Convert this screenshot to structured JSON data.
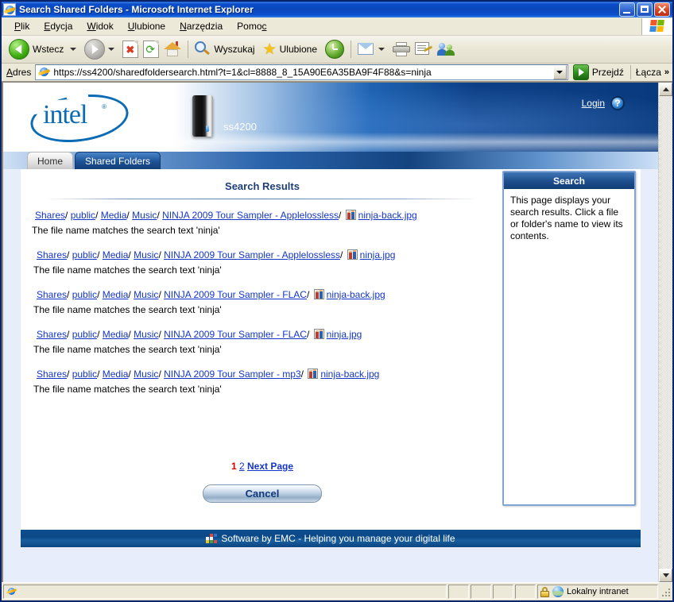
{
  "window": {
    "title": "Search Shared Folders - Microsoft Internet Explorer",
    "minimize_label": "Minimize",
    "maximize_label": "Maximize",
    "close_label": "Close"
  },
  "menu": {
    "items": [
      {
        "prefix": "",
        "accel": "P",
        "suffix": "lik"
      },
      {
        "prefix": "",
        "accel": "E",
        "suffix": "dycja"
      },
      {
        "prefix": "",
        "accel": "W",
        "suffix": "idok"
      },
      {
        "prefix": "",
        "accel": "U",
        "suffix": "lubione"
      },
      {
        "prefix": "",
        "accel": "N",
        "suffix": "arzędzia"
      },
      {
        "prefix": "Pomo",
        "accel": "c",
        "suffix": ""
      }
    ]
  },
  "toolbar": {
    "back_label": "Wstecz",
    "forward_label": "Forward",
    "stop_label": "Stop",
    "refresh_label": "Refresh",
    "home_label": "Home",
    "search_label": "Wyszukaj",
    "favorites_label": "Ulubione",
    "history_label": "History",
    "mail_label": "Mail",
    "print_label": "Print",
    "edit_label": "Edit",
    "messenger_label": "Messenger"
  },
  "address_bar": {
    "label": "Adres",
    "url": "https://ss4200/sharedfoldersearch.html?t=1&cl=8888_8_15A90E6A35BA9F4F88&s=ninja",
    "go_label": "Przejdź",
    "links_label": "Łącza",
    "links_chevron": "»"
  },
  "app_header": {
    "brand": "intel",
    "brand_reg": "®",
    "device_name": "ss4200",
    "login_label": "Login",
    "help_label": "?"
  },
  "tabs": [
    {
      "label": "Home",
      "active": false
    },
    {
      "label": "Shared Folders",
      "active": true
    }
  ],
  "main": {
    "heading": "Search Results",
    "results": [
      {
        "crumbs": [
          "Shares",
          "public",
          "Media",
          "Music",
          "NINJA 2009 Tour Sampler - Applelossless"
        ],
        "file": "ninja-back.jpg",
        "match": "The file name matches the search text 'ninja'"
      },
      {
        "crumbs": [
          "Shares",
          "public",
          "Media",
          "Music",
          "NINJA 2009 Tour Sampler - Applelossless"
        ],
        "file": "ninja.jpg",
        "match": "The file name matches the search text 'ninja'"
      },
      {
        "crumbs": [
          "Shares",
          "public",
          "Media",
          "Music",
          "NINJA 2009 Tour Sampler - FLAC"
        ],
        "file": "ninja-back.jpg",
        "match": "The file name matches the search text 'ninja'"
      },
      {
        "crumbs": [
          "Shares",
          "public",
          "Media",
          "Music",
          "NINJA 2009 Tour Sampler - FLAC"
        ],
        "file": "ninja.jpg",
        "match": "The file name matches the search text 'ninja'"
      },
      {
        "crumbs": [
          "Shares",
          "public",
          "Media",
          "Music",
          "NINJA 2009 Tour Sampler - mp3"
        ],
        "file": "ninja-back.jpg",
        "match": "The file name matches the search text 'ninja'"
      }
    ],
    "pager": {
      "current": "1",
      "page_two": "2",
      "next": "Next Page"
    },
    "cancel_label": "Cancel"
  },
  "side_panel": {
    "title": "Search",
    "body": "This page displays your search results. Click a file or folder's name to view its contents."
  },
  "footer": {
    "text": "Software by EMC - Helping you manage your digital life"
  },
  "status_bar": {
    "zone": "Lokalny intranet"
  },
  "colors": {
    "link": "#1436c8",
    "heading": "#1d3f75",
    "accent_blue": "#0b4e90",
    "current_page": "#cc0000",
    "intel_blue": "#0b6cb5"
  }
}
